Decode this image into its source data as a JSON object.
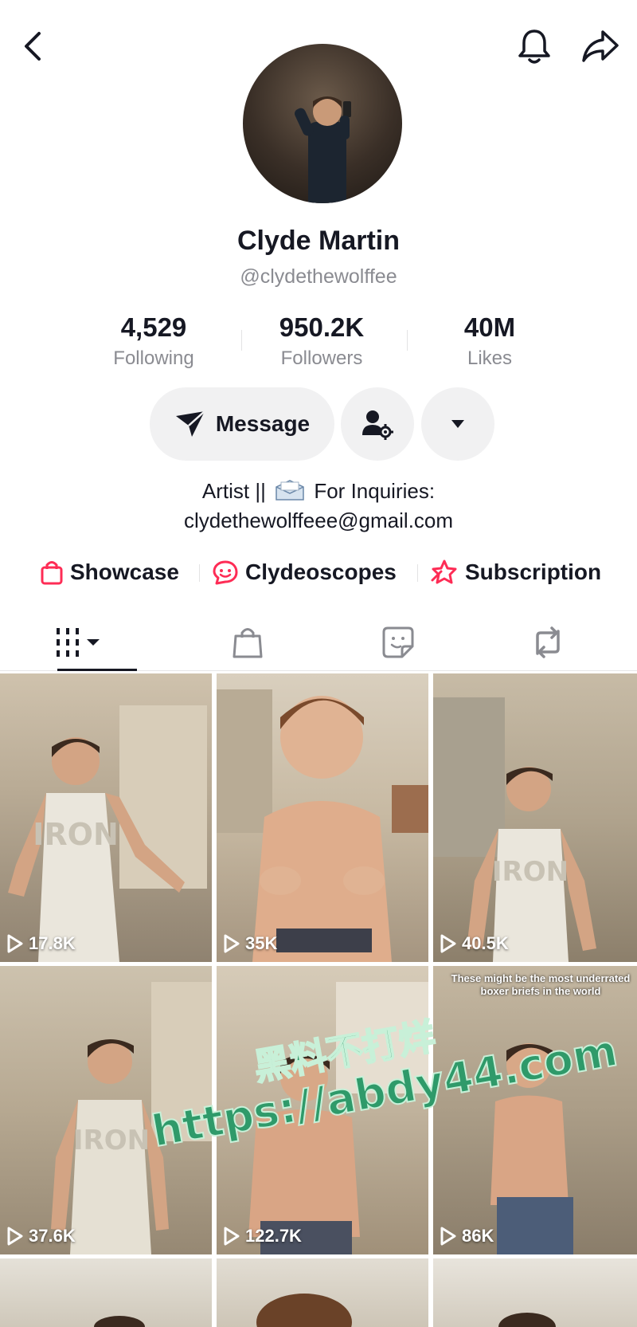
{
  "profile": {
    "name": "Clyde Martin",
    "handle": "@clydethewolffee"
  },
  "stats": [
    {
      "value": "4,529",
      "label": "Following"
    },
    {
      "value": "950.2K",
      "label": "Followers"
    },
    {
      "value": "40M",
      "label": "Likes"
    }
  ],
  "actions": {
    "message_label": "Message"
  },
  "bio": {
    "line1_prefix": "Artist ||",
    "line1_suffix": "For Inquiries:",
    "line2": "clydethewolffeee@gmail.com"
  },
  "links": [
    {
      "label": "Showcase",
      "icon": "shopping-bag-icon"
    },
    {
      "label": "Clydeoscopes",
      "icon": "sticker-smile-icon"
    },
    {
      "label": "Subscription",
      "icon": "star-badge-icon"
    }
  ],
  "tabs": [
    {
      "icon": "grid-videos-icon",
      "active": true
    },
    {
      "icon": "shopping-bag-icon",
      "active": false
    },
    {
      "icon": "sticker-icon",
      "active": false
    },
    {
      "icon": "repost-icon",
      "active": false
    }
  ],
  "videos": [
    {
      "views": "17.8K"
    },
    {
      "views": "35K"
    },
    {
      "views": "40.5K"
    },
    {
      "views": "37.6K"
    },
    {
      "views": "122.7K"
    },
    {
      "views": "86K",
      "caption": "These might be the most underrated boxer briefs in the world"
    }
  ],
  "watermark": {
    "line1": "黑料不打烊",
    "line2": "https://abdy44.com"
  },
  "colors": {
    "accent": "#fe2c55",
    "text": "#161823",
    "muted": "#8a8b91",
    "button_bg": "#f1f1f2",
    "watermark": "#2f9a6a"
  }
}
